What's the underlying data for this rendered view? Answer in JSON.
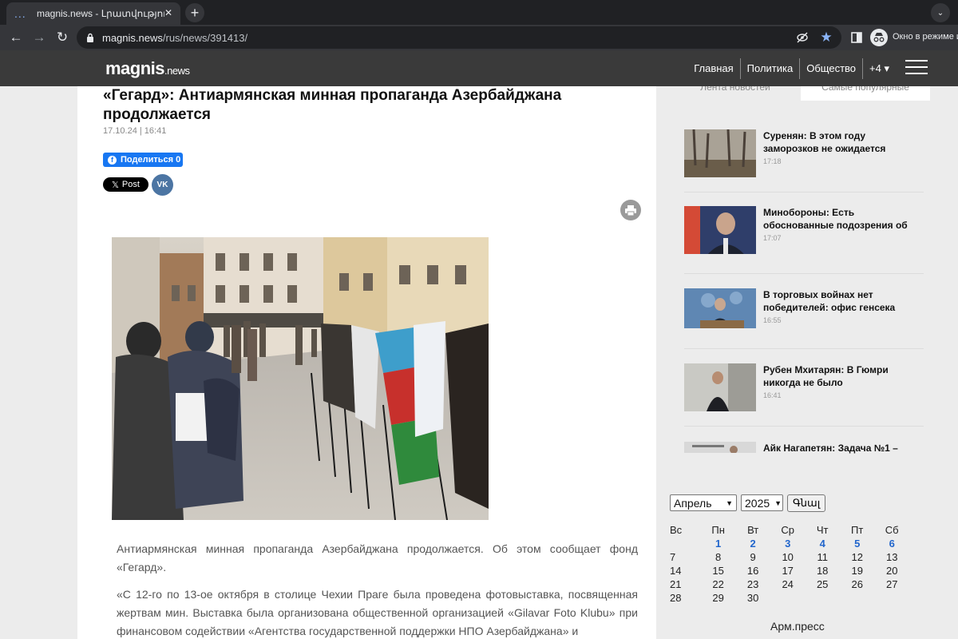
{
  "browser": {
    "tab_title": "magnis.news - Լրատվություն Հա",
    "tab_loading": "...",
    "tab_close": "✕",
    "new_tab": "+",
    "tab_menu": "⌄",
    "url_domain": "magnis.news",
    "url_path": "/rus/news/391413/",
    "incognito_label": "Окно в режиме и"
  },
  "site": {
    "logo_main": "magnis",
    "logo_suffix": ".news",
    "menu": [
      {
        "label": "Главная"
      },
      {
        "label": "Политика"
      },
      {
        "label": "Общество"
      },
      {
        "label": "+4 ▾"
      }
    ]
  },
  "article": {
    "title": "«Гегард»: Антиармянская минная пропаганда Азербайджана продолжается",
    "date": "17.10.24 | 16:41",
    "fb_share": "Поделиться 0",
    "x_post": "Post",
    "vk_label": "VK",
    "paragraphs": [
      "Антиармянская минная пропаганда Азербайджана продолжается. Об этом сообщает фонд «Гегард».",
      "«С 12-го по 13-ое октября в столице Чехии Праге была проведена фотовыставка, посвященная жертвам мин. Выставка была организована общественной организацией «Gilavar Foto Klubu» при финансовом содействии «Агентства государственной поддержки НПО Азербайджана» и"
    ]
  },
  "sidebar": {
    "tabs": [
      "Лента новостей",
      "Самые популярные"
    ],
    "news": [
      {
        "title": "Суренян: В этом году заморозков не ожидается",
        "time": "17:18"
      },
      {
        "title": "Минобороны: Есть обоснованные подозрения об",
        "time": "17:07"
      },
      {
        "title": "В торговых войнах нет победителей: офис генсека",
        "time": "16:55"
      },
      {
        "title": "Рубен Мхитарян: В Гюмри никогда не было",
        "time": "16:41"
      },
      {
        "title": "Айк Нагапетян: Задача №1 –",
        "time": ""
      }
    ]
  },
  "calendar": {
    "month": "Апрель",
    "year": "2025",
    "go_button": "Գնալ",
    "weekdays": [
      "Вс",
      "Пн",
      "Вт",
      "Ср",
      "Чт",
      "Пт",
      "Сб"
    ],
    "weeks": [
      [
        "",
        "1",
        "2",
        "3",
        "4",
        "5",
        "6"
      ],
      [
        "7",
        "8",
        "9",
        "10",
        "11",
        "12",
        "13"
      ],
      [
        "14",
        "15",
        "16",
        "17",
        "18",
        "19",
        "20"
      ],
      [
        "21",
        "22",
        "23",
        "24",
        "25",
        "26",
        "27"
      ],
      [
        "28",
        "29",
        "30",
        "",
        "",
        "",
        ""
      ]
    ],
    "linked_days": [
      "1",
      "2",
      "3",
      "4",
      "5",
      "6"
    ],
    "footer": "Арм.пресс"
  },
  "colors": {
    "accent_blue": "#2266cc",
    "facebook": "#1877f2",
    "vk": "#4c75a3",
    "header_bg": "#3a3a3a"
  }
}
